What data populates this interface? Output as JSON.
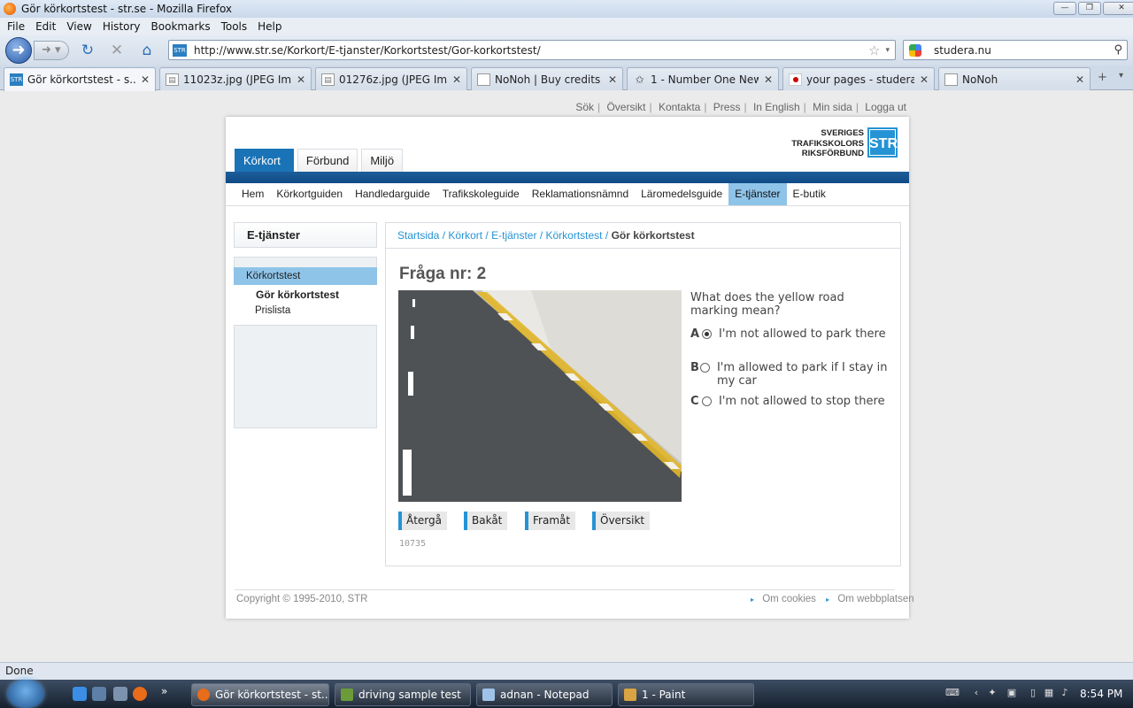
{
  "window": {
    "title": "Gör körkortstest - str.se - Mozilla Firefox"
  },
  "menu": [
    "File",
    "Edit",
    "View",
    "History",
    "Bookmarks",
    "Tools",
    "Help"
  ],
  "urlbar": {
    "url": "http://www.str.se/Korkort/E-tjanster/Korkortstest/Gor-korkortstest/"
  },
  "search": {
    "value": "studera.nu"
  },
  "tabs": [
    {
      "label": "Gör körkortstest - s...",
      "icon": "str-favicon",
      "active": true
    },
    {
      "label": "11023z.jpg (JPEG Ima...",
      "icon": "image-icon"
    },
    {
      "label": "01276z.jpg (JPEG Ima...",
      "icon": "image-icon"
    },
    {
      "label": "NoNoh | Buy credits ...",
      "icon": "page-icon"
    },
    {
      "label": "1 - Number One New...",
      "icon": "star-logo-icon"
    },
    {
      "label": "your pages - studera....",
      "icon": "japan-flag-icon"
    },
    {
      "label": "NoNoh",
      "icon": "page-icon"
    }
  ],
  "site": {
    "top_links": [
      "Sök",
      "Översikt",
      "Kontakta",
      "Press",
      "In English",
      "Min sida",
      "Logga ut"
    ],
    "section_tabs": [
      "Körkort",
      "Förbund",
      "Miljö"
    ],
    "logo": {
      "line1": "SVERIGES",
      "line2": "TRAFIKSKOLORS",
      "line3": "RIKSFÖRBUND",
      "badge": "STR"
    },
    "main_nav": [
      "Hem",
      "Körkortguiden",
      "Handledarguide",
      "Trafikskoleguide",
      "Reklamationsnämnd",
      "Läromedelsguide",
      "E-tjänster",
      "E-butik"
    ],
    "active_nav": "E-tjänster",
    "sidebar": {
      "heading": "E-tjänster",
      "selected": "Körkortstest",
      "items": [
        "Gör körkortstest",
        "Prislista"
      ]
    },
    "breadcrumb": {
      "links": [
        "Startsida",
        "Körkort",
        "E-tjänster",
        "Körkortstest"
      ],
      "current": "Gör körkortstest",
      "separator": "/"
    },
    "question": {
      "title": "Fråga nr: 2",
      "text": "What does the yellow road marking mean?",
      "options": [
        {
          "letter": "A",
          "text": "I'm not allowed to park there",
          "selected": true
        },
        {
          "letter": "B",
          "text": "I'm allowed to park if I stay in my car",
          "selected": false
        },
        {
          "letter": "C",
          "text": "I'm not allowed to stop there",
          "selected": false
        }
      ],
      "buttons": [
        "Återgå",
        "Bakåt",
        "Framåt",
        "Översikt"
      ],
      "id": "10735"
    },
    "footer": {
      "copyright": "Copyright © 1995-2010, STR",
      "links": [
        "Om cookies",
        "Om webbplatsen"
      ]
    },
    "colors": {
      "brand_blue": "#1a73b6",
      "accent_light": "#8fc4e9",
      "link": "#2693d4"
    }
  },
  "status": {
    "text": "Done"
  },
  "taskbar": {
    "buttons": [
      {
        "label": "Gör körkortstest - st...",
        "active": true
      },
      {
        "label": "driving sample test"
      },
      {
        "label": "adnan - Notepad"
      },
      {
        "label": "1 - Paint"
      }
    ],
    "clock": "8:54 PM"
  }
}
